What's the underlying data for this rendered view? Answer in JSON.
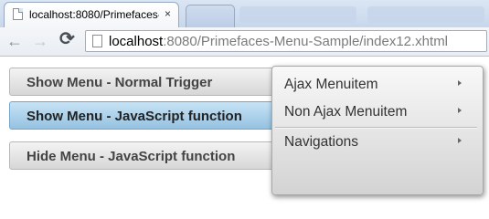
{
  "browser": {
    "tab_title": "localhost:8080/Primefaces-Menu-Sample/index12.xhtml",
    "tab_close": "×",
    "nav": {
      "back": "←",
      "forward": "→",
      "reload": "⟳"
    },
    "url_host": "localhost",
    "url_rest": ":8080/Primefaces-Menu-Sample/index12.xhtml"
  },
  "page": {
    "buttons": [
      {
        "label": "Show Menu - Normal Trigger"
      },
      {
        "label": "Show Menu - JavaScript function"
      },
      {
        "label": "Hide Menu - JavaScript function"
      }
    ]
  },
  "context_menu": {
    "items": [
      {
        "label": "Ajax Menuitem",
        "has_submenu": true
      },
      {
        "label": "Non Ajax Menuitem",
        "has_submenu": true
      },
      {
        "label": "Navigations",
        "has_submenu": true
      }
    ]
  },
  "colors": {
    "active_button": "#95c2e1",
    "tabstrip": "#c7d7ec"
  }
}
